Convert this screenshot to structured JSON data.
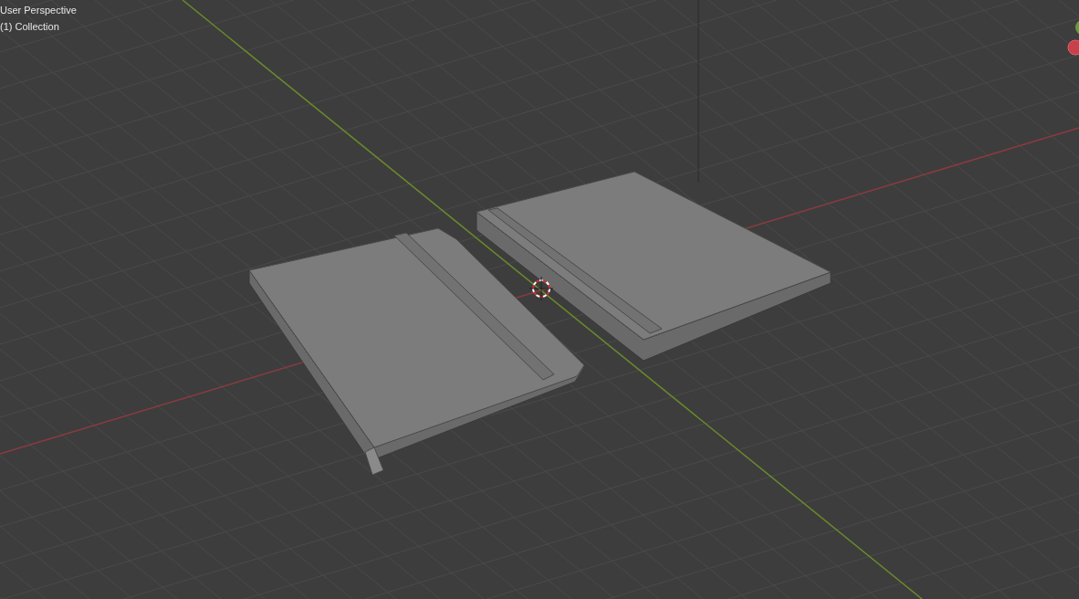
{
  "viewport": {
    "view_name": "User Perspective",
    "collection": "(1) Collection"
  }
}
